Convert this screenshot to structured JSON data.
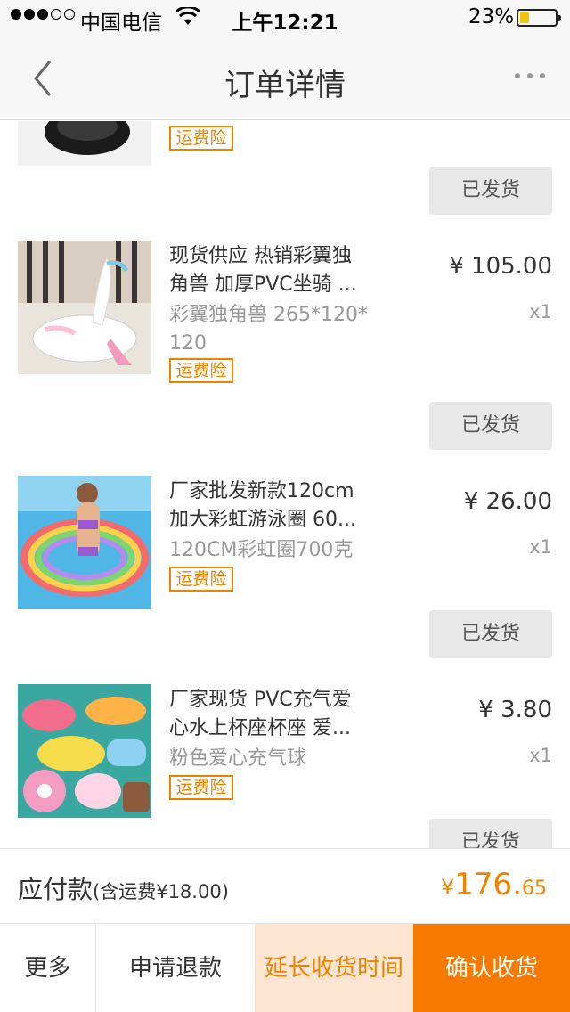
{
  "status_bar": {
    "carrier": "中国电信",
    "time": "上午12:21",
    "battery": "23%"
  },
  "nav": {
    "title": "订单详情"
  },
  "items": [
    {
      "title_line1": "现货供应 热销彩翼独",
      "title_line2": "角兽 加厚PVC坐骑 ...",
      "spec": "彩翼独角兽 265*120* 120",
      "price": "¥ 105.00",
      "qty": "x1",
      "insurance_tag": "运费险",
      "status_button": "已发货",
      "thumb_icon": "unicorn-float-photo"
    },
    {
      "title_line1": "厂家批发新款120cm",
      "title_line2": "加大彩虹游泳圈 60...",
      "spec": "120CM彩虹圈700克",
      "price": "¥ 26.00",
      "qty": "x1",
      "insurance_tag": "运费险",
      "status_button": "已发货",
      "thumb_icon": "rainbow-swim-ring-photo"
    },
    {
      "title_line1": "厂家现货 PVC充气爱",
      "title_line2": "心水上杯座杯座 爱...",
      "spec": "粉色爱心充气球",
      "price": "¥ 3.80",
      "qty": "x1",
      "insurance_tag": "运费险",
      "status_button": "已发货",
      "thumb_icon": "inflatable-cup-holders-photo"
    }
  ],
  "top_partial": {
    "insurance_tag": "运费险",
    "status_button": "已发货"
  },
  "total": {
    "label": "应付款",
    "shipping_note": "(含运费¥18.00)",
    "currency": "¥",
    "amount_int": "176.",
    "amount_cents": "65"
  },
  "actions": {
    "more": "更多",
    "refund": "申请退款",
    "extend": "延长收货时间",
    "confirm": "确认收货"
  },
  "colors": {
    "accent": "#f77a00",
    "accent_light": "#fde6d1",
    "tag_orange": "#f08200"
  }
}
